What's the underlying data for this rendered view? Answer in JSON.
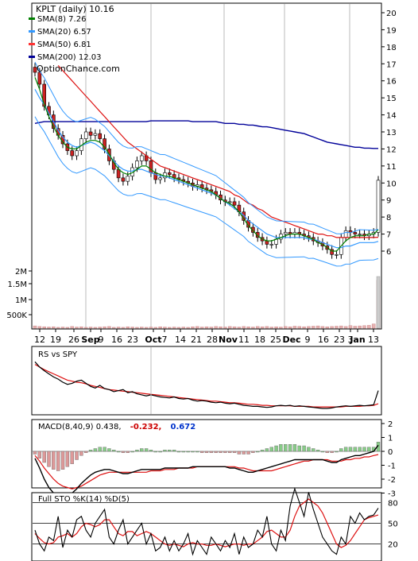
{
  "chart_data": [
    {
      "type": "candlestick",
      "title": "KPLT (daily) 10.16",
      "watermark": "OptionChance.com",
      "y_ticks": [
        "20",
        "19",
        "18",
        "17",
        "16",
        "15",
        "14",
        "13",
        "12",
        "11",
        "10",
        "9",
        "8",
        "7",
        "6"
      ],
      "volume_ticks": [
        "2M",
        "1.5M",
        "1M",
        "500K"
      ],
      "x_ticks": [
        "12",
        "19",
        "26",
        "Sep",
        "9",
        "16",
        "23",
        "Oct",
        "7",
        "14",
        "21",
        "28",
        "Nov",
        "11",
        "18",
        "25",
        "Dec",
        "9",
        "16",
        "23",
        "3",
        "Jan",
        "13"
      ],
      "ylim": [
        5,
        20
      ],
      "legend": [
        {
          "name": "SMA(8) 7.26",
          "color": "#008000"
        },
        {
          "name": "SMA(20) 6.57",
          "color": "#3399ff"
        },
        {
          "name": "SMA(50) 6.81",
          "color": "#ff3333"
        },
        {
          "name": "SMA(200) 12.03",
          "color": "#000099"
        }
      ],
      "close": [
        16.5,
        15.8,
        14.5,
        14.0,
        13.2,
        12.8,
        12.3,
        11.9,
        11.6,
        11.9,
        12.6,
        13.0,
        12.8,
        12.9,
        12.6,
        12.0,
        11.3,
        10.8,
        10.3,
        10.1,
        10.4,
        10.9,
        11.3,
        11.6,
        11.3,
        10.6,
        10.2,
        10.3,
        10.6,
        10.5,
        10.3,
        10.2,
        10.1,
        10.0,
        9.8,
        9.9,
        9.7,
        9.6,
        9.5,
        9.3,
        9.0,
        8.9,
        8.9,
        8.7,
        8.3,
        7.8,
        7.4,
        7.1,
        6.8,
        6.6,
        6.4,
        6.4,
        6.7,
        7.0,
        7.1,
        7.0,
        7.1,
        7.0,
        6.9,
        6.8,
        6.6,
        6.5,
        6.3,
        6.1,
        5.8,
        5.8,
        6.8,
        7.2,
        7.1,
        7.0,
        7.0,
        6.9,
        7.0,
        7.1,
        10.16
      ],
      "sma8": [
        16.2,
        15.5,
        14.6,
        13.9,
        13.3,
        12.8,
        12.4,
        12.1,
        12.0,
        12.0,
        12.2,
        12.4,
        12.5,
        12.5,
        12.4,
        12.1,
        11.7,
        11.2,
        10.8,
        10.6,
        10.5,
        10.6,
        10.8,
        11.0,
        11.0,
        10.8,
        10.6,
        10.5,
        10.4,
        10.4,
        10.3,
        10.2,
        10.1,
        10.0,
        9.9,
        9.8,
        9.7,
        9.6,
        9.5,
        9.3,
        9.1,
        8.9,
        8.8,
        8.6,
        8.3,
        7.9,
        7.5,
        7.2,
        6.9,
        6.7,
        6.6,
        6.6,
        6.7,
        6.8,
        6.9,
        7.0,
        7.0,
        7.0,
        6.9,
        6.8,
        6.7,
        6.5,
        6.4,
        6.2,
        6.0,
        6.0,
        6.3,
        6.6,
        6.8,
        6.9,
        6.9,
        6.9,
        7.0,
        7.0,
        7.26
      ],
      "sma20": [
        15.5,
        15.0,
        14.6,
        14.1,
        13.6,
        13.1,
        12.7,
        12.4,
        12.2,
        12.1,
        12.2,
        12.3,
        12.4,
        12.3,
        12.1,
        11.9,
        11.6,
        11.3,
        11.0,
        10.8,
        10.7,
        10.7,
        10.8,
        10.8,
        10.7,
        10.6,
        10.5,
        10.4,
        10.4,
        10.3,
        10.2,
        10.1,
        10.0,
        9.9,
        9.8,
        9.7,
        9.6,
        9.5,
        9.4,
        9.3,
        9.1,
        8.9,
        8.7,
        8.5,
        8.3,
        8.1,
        7.8,
        7.6,
        7.4,
        7.2,
        7.0,
        6.9,
        6.8,
        6.8,
        6.8,
        6.8,
        6.8,
        6.8,
        6.8,
        6.7,
        6.7,
        6.6,
        6.5,
        6.4,
        6.3,
        6.2,
        6.2,
        6.3,
        6.3,
        6.4,
        6.5,
        6.5,
        6.5,
        6.5,
        6.57
      ],
      "sma50": [
        null,
        null,
        null,
        null,
        null,
        16.9,
        16.6,
        16.3,
        16.0,
        15.7,
        15.4,
        15.1,
        14.8,
        14.5,
        14.2,
        13.9,
        13.6,
        13.3,
        13.0,
        12.7,
        12.4,
        12.2,
        12.0,
        11.8,
        11.6,
        11.4,
        11.2,
        11.0,
        10.9,
        10.8,
        10.7,
        10.6,
        10.5,
        10.4,
        10.3,
        10.2,
        10.1,
        10.0,
        9.9,
        9.8,
        9.7,
        9.6,
        9.5,
        9.3,
        9.2,
        9.0,
        8.8,
        8.7,
        8.5,
        8.4,
        8.2,
        8.0,
        7.9,
        7.8,
        7.7,
        7.6,
        7.5,
        7.4,
        7.3,
        7.2,
        7.1,
        7.0,
        7.0,
        6.9,
        6.9,
        6.8,
        6.8,
        6.8,
        6.8,
        6.8,
        6.8,
        6.8,
        6.8,
        6.8,
        6.81
      ],
      "sma200": [
        13.5,
        13.55,
        13.6,
        13.6,
        13.6,
        13.6,
        13.6,
        13.6,
        13.6,
        13.6,
        13.6,
        13.6,
        13.6,
        13.6,
        13.6,
        13.6,
        13.6,
        13.6,
        13.6,
        13.6,
        13.6,
        13.6,
        13.6,
        13.6,
        13.6,
        13.65,
        13.65,
        13.65,
        13.65,
        13.65,
        13.65,
        13.65,
        13.65,
        13.65,
        13.6,
        13.6,
        13.6,
        13.6,
        13.6,
        13.6,
        13.55,
        13.5,
        13.5,
        13.5,
        13.45,
        13.45,
        13.4,
        13.4,
        13.35,
        13.3,
        13.3,
        13.25,
        13.2,
        13.15,
        13.1,
        13.05,
        13.0,
        12.95,
        12.9,
        12.8,
        12.7,
        12.6,
        12.5,
        12.4,
        12.35,
        12.3,
        12.25,
        12.2,
        12.15,
        12.1,
        12.1,
        12.05,
        12.05,
        12.03,
        12.03
      ],
      "volume": [
        80,
        60,
        50,
        40,
        50,
        30,
        40,
        30,
        60,
        40,
        50,
        30,
        40,
        30,
        40,
        50,
        60,
        30,
        40,
        30,
        50,
        40,
        30,
        40,
        30,
        40,
        30,
        50,
        40,
        30,
        40,
        30,
        40,
        30,
        50,
        60,
        40,
        50,
        40,
        60,
        50,
        40,
        60,
        50,
        40,
        60,
        50,
        40,
        60,
        50,
        60,
        40,
        50,
        40,
        60,
        50,
        70,
        60,
        50,
        60,
        70,
        80,
        60,
        50,
        60,
        70,
        80,
        60,
        90,
        70,
        80,
        90,
        100,
        150,
        1700
      ]
    },
    {
      "type": "line",
      "title": "RS vs SPY",
      "series": [
        {
          "values": [
            0.95,
            0.85,
            0.78,
            0.72,
            0.66,
            0.62,
            0.56,
            0.52,
            0.54,
            0.58,
            0.6,
            0.54,
            0.48,
            0.45,
            0.5,
            0.44,
            0.42,
            0.38,
            0.4,
            0.42,
            0.36,
            0.38,
            0.34,
            0.32,
            0.3,
            0.32,
            0.3,
            0.28,
            0.27,
            0.26,
            0.28,
            0.25,
            0.24,
            0.25,
            0.22,
            0.2,
            0.21,
            0.2,
            0.18,
            0.17,
            0.18,
            0.16,
            0.15,
            0.16,
            0.14,
            0.12,
            0.11,
            0.1,
            0.1,
            0.09,
            0.08,
            0.09,
            0.11,
            0.12,
            0.11,
            0.12,
            0.1,
            0.11,
            0.1,
            0.09,
            0.08,
            0.07,
            0.06,
            0.06,
            0.07,
            0.09,
            0.1,
            0.11,
            0.1,
            0.11,
            0.12,
            0.11,
            0.12,
            0.13,
            0.4
          ]
        },
        {
          "values": [
            0.9,
            0.85,
            0.8,
            0.76,
            0.72,
            0.68,
            0.64,
            0.6,
            0.58,
            0.56,
            0.55,
            0.53,
            0.5,
            0.48,
            0.46,
            0.44,
            0.42,
            0.41,
            0.4,
            0.39,
            0.38,
            0.37,
            0.36,
            0.35,
            0.34,
            0.33,
            0.32,
            0.31,
            0.3,
            0.29,
            0.28,
            0.27,
            0.26,
            0.25,
            0.24,
            0.23,
            0.22,
            0.21,
            0.2,
            0.2,
            0.19,
            0.18,
            0.17,
            0.17,
            0.16,
            0.15,
            0.14,
            0.14,
            0.13,
            0.12,
            0.12,
            0.11,
            0.11,
            0.11,
            0.11,
            0.11,
            0.1,
            0.1,
            0.1,
            0.1,
            0.09,
            0.09,
            0.09,
            0.09,
            0.09,
            0.09,
            0.09,
            0.1,
            0.1,
            0.1,
            0.1,
            0.11,
            0.11,
            0.12,
            0.15
          ]
        }
      ]
    },
    {
      "type": "bar+line",
      "title": "MACD(8,40,9) 0.438,",
      "value_1": "-0.232,",
      "value_2": "0.672",
      "y_ticks": [
        "2",
        "1",
        "0",
        "-1",
        "-2",
        "-3"
      ],
      "ylim": [
        -3.5,
        2.2
      ],
      "histogram": [
        -0.2,
        -0.5,
        -0.8,
        -1.1,
        -1.3,
        -1.4,
        -1.3,
        -1.1,
        -0.9,
        -0.6,
        -0.3,
        -0.1,
        0.1,
        0.2,
        0.3,
        0.3,
        0.2,
        0.1,
        0.0,
        -0.1,
        -0.1,
        0.0,
        0.1,
        0.2,
        0.2,
        0.1,
        0.0,
        0.0,
        0.1,
        0.1,
        0.1,
        0.0,
        0.0,
        0.0,
        0.0,
        0.0,
        -0.1,
        -0.1,
        -0.1,
        -0.1,
        -0.1,
        -0.1,
        -0.1,
        -0.1,
        -0.2,
        -0.2,
        -0.2,
        -0.1,
        0.0,
        0.1,
        0.2,
        0.3,
        0.4,
        0.5,
        0.5,
        0.5,
        0.5,
        0.4,
        0.4,
        0.3,
        0.2,
        0.1,
        0.0,
        -0.1,
        -0.1,
        0.0,
        0.2,
        0.3,
        0.3,
        0.3,
        0.3,
        0.3,
        0.3,
        0.3,
        0.67
      ],
      "macd": [
        -0.5,
        -1.2,
        -2.0,
        -2.6,
        -3.0,
        -3.2,
        -3.3,
        -3.2,
        -3.0,
        -2.7,
        -2.3,
        -2.0,
        -1.7,
        -1.5,
        -1.4,
        -1.3,
        -1.3,
        -1.4,
        -1.5,
        -1.6,
        -1.6,
        -1.5,
        -1.4,
        -1.3,
        -1.3,
        -1.3,
        -1.3,
        -1.3,
        -1.2,
        -1.2,
        -1.2,
        -1.2,
        -1.2,
        -1.2,
        -1.1,
        -1.1,
        -1.1,
        -1.1,
        -1.1,
        -1.1,
        -1.1,
        -1.1,
        -1.2,
        -1.2,
        -1.3,
        -1.4,
        -1.5,
        -1.5,
        -1.4,
        -1.3,
        -1.2,
        -1.1,
        -1.0,
        -0.9,
        -0.8,
        -0.7,
        -0.6,
        -0.6,
        -0.6,
        -0.6,
        -0.6,
        -0.6,
        -0.6,
        -0.7,
        -0.8,
        -0.8,
        -0.6,
        -0.5,
        -0.4,
        -0.3,
        -0.3,
        -0.2,
        -0.1,
        0.0,
        0.44
      ],
      "signal": [
        -0.3,
        -0.7,
        -1.2,
        -1.6,
        -2.0,
        -2.3,
        -2.5,
        -2.6,
        -2.7,
        -2.6,
        -2.5,
        -2.3,
        -2.1,
        -1.9,
        -1.7,
        -1.6,
        -1.5,
        -1.5,
        -1.5,
        -1.5,
        -1.5,
        -1.5,
        -1.5,
        -1.5,
        -1.5,
        -1.4,
        -1.4,
        -1.4,
        -1.3,
        -1.3,
        -1.3,
        -1.2,
        -1.2,
        -1.2,
        -1.2,
        -1.1,
        -1.1,
        -1.1,
        -1.1,
        -1.1,
        -1.1,
        -1.1,
        -1.1,
        -1.1,
        -1.2,
        -1.2,
        -1.3,
        -1.4,
        -1.4,
        -1.4,
        -1.4,
        -1.4,
        -1.3,
        -1.2,
        -1.1,
        -1.0,
        -0.9,
        -0.8,
        -0.7,
        -0.7,
        -0.6,
        -0.6,
        -0.6,
        -0.6,
        -0.7,
        -0.7,
        -0.7,
        -0.6,
        -0.6,
        -0.5,
        -0.5,
        -0.4,
        -0.4,
        -0.3,
        -0.23
      ]
    },
    {
      "type": "line",
      "title": "Full STO %K(14) %D(5)",
      "y_ticks": [
        "80",
        "50",
        "20"
      ],
      "ylim": [
        0,
        100
      ],
      "k": [
        40,
        20,
        10,
        30,
        25,
        60,
        15,
        40,
        30,
        55,
        60,
        40,
        30,
        50,
        60,
        70,
        30,
        20,
        40,
        55,
        20,
        30,
        40,
        50,
        20,
        35,
        10,
        15,
        30,
        10,
        25,
        10,
        20,
        35,
        5,
        25,
        15,
        5,
        30,
        20,
        10,
        25,
        15,
        35,
        5,
        30,
        15,
        20,
        40,
        30,
        60,
        20,
        10,
        40,
        25,
        75,
        100,
        80,
        60,
        95,
        70,
        50,
        30,
        20,
        10,
        5,
        30,
        20,
        60,
        50,
        65,
        55,
        60,
        62,
        72
      ],
      "d": [
        35,
        28,
        22,
        20,
        22,
        30,
        32,
        35,
        30,
        35,
        45,
        50,
        48,
        45,
        48,
        55,
        55,
        45,
        35,
        32,
        38,
        38,
        32,
        35,
        38,
        35,
        30,
        25,
        20,
        18,
        20,
        18,
        16,
        20,
        22,
        20,
        20,
        18,
        18,
        20,
        18,
        16,
        18,
        20,
        20,
        18,
        20,
        20,
        25,
        30,
        38,
        40,
        35,
        30,
        30,
        40,
        60,
        75,
        80,
        85,
        80,
        75,
        65,
        50,
        35,
        20,
        15,
        18,
        25,
        35,
        45,
        55,
        58,
        60,
        62
      ]
    }
  ]
}
